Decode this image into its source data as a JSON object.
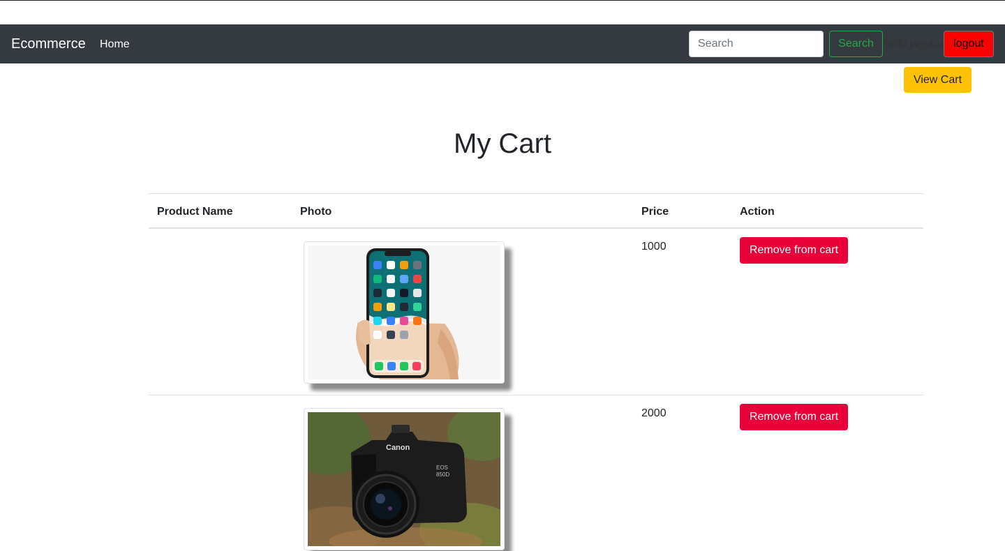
{
  "navbar": {
    "brand": "Ecommerce",
    "home_label": "Home",
    "search_placeholder": "Search",
    "search_button": "Search",
    "greeting": "hello jaguuu",
    "logout_label": "logout"
  },
  "view_cart_label": "View Cart",
  "page_title": "My Cart",
  "table": {
    "headers": [
      "Product Name",
      "Photo",
      "Price",
      "Action"
    ],
    "rows": [
      {
        "name": "",
        "photo": "phone-photo",
        "price": "1000",
        "action": "Remove from cart"
      },
      {
        "name": "",
        "photo": "camera-photo",
        "price": "2000",
        "action": "Remove from cart"
      }
    ]
  },
  "colors": {
    "navbar_bg": "#343a40",
    "search_green": "#28a745",
    "logout_red": "#ff0000",
    "view_cart_yellow": "#ffc107",
    "remove_red": "#ea0039"
  }
}
